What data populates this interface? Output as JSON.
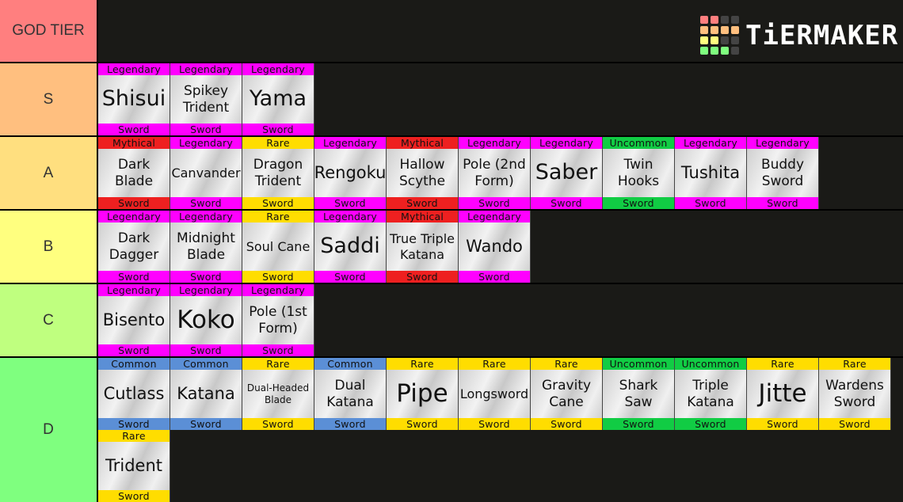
{
  "logo": {
    "text": "TiERMAKER",
    "grid_colors": [
      "#ff7f7f",
      "#ff7f7f",
      "#444444",
      "#444444",
      "#ffbf7f",
      "#ffbf7f",
      "#ffbf7f",
      "#ffbf7f",
      "#ffff7f",
      "#ffff7f",
      "#444444",
      "#444444",
      "#7fff7f",
      "#7fff7f",
      "#7fff7f",
      "#444444"
    ]
  },
  "rarity_colors": {
    "Legendary": "#ff00ff",
    "Mythical": "#ee2020",
    "Rare": "#ffdd00",
    "Uncommon": "#11cc44",
    "Common": "#5b8fd6"
  },
  "tiers": [
    {
      "label": "GOD TIER",
      "color": "#ff7f7f",
      "items": []
    },
    {
      "label": "S",
      "color": "#ffbf7f",
      "items": [
        {
          "name": "Shisui",
          "rarity": "Legendary",
          "type": "Sword",
          "size": "l"
        },
        {
          "name": "Spikey Trident",
          "rarity": "Legendary",
          "type": "Sword",
          "size": "s"
        },
        {
          "name": "Yama",
          "rarity": "Legendary",
          "type": "Sword",
          "size": "l"
        }
      ]
    },
    {
      "label": "A",
      "color": "#ffdf7f",
      "items": [
        {
          "name": "Dark Blade",
          "rarity": "Mythical",
          "type": "Sword",
          "size": "s"
        },
        {
          "name": "Canvander",
          "rarity": "Legendary",
          "type": "Sword",
          "size": "xs"
        },
        {
          "name": "Dragon Trident",
          "rarity": "Rare",
          "type": "Sword",
          "size": "s"
        },
        {
          "name": "Rengoku",
          "rarity": "Legendary",
          "type": "Sword",
          "size": "m"
        },
        {
          "name": "Hallow Scythe",
          "rarity": "Mythical",
          "type": "Sword",
          "size": "s"
        },
        {
          "name": "Pole (2nd Form)",
          "rarity": "Legendary",
          "type": "Sword",
          "size": "s"
        },
        {
          "name": "Saber",
          "rarity": "Legendary",
          "type": "Sword",
          "size": "l"
        },
        {
          "name": "Twin Hooks",
          "rarity": "Uncommon",
          "type": "Sword",
          "size": "s"
        },
        {
          "name": "Tushita",
          "rarity": "Legendary",
          "type": "Sword",
          "size": "m"
        },
        {
          "name": "Buddy Sword",
          "rarity": "Legendary",
          "type": "Sword",
          "size": "s"
        }
      ]
    },
    {
      "label": "B",
      "color": "#ffff7f",
      "items": [
        {
          "name": "Dark Dagger",
          "rarity": "Legendary",
          "type": "Sword",
          "size": "s"
        },
        {
          "name": "Midnight Blade",
          "rarity": "Legendary",
          "type": "Sword",
          "size": "s"
        },
        {
          "name": "Soul Cane",
          "rarity": "Rare",
          "type": "Sword",
          "size": "xs"
        },
        {
          "name": "Saddi",
          "rarity": "Legendary",
          "type": "Sword",
          "size": "l"
        },
        {
          "name": "True Triple Katana",
          "rarity": "Mythical",
          "type": "Sword",
          "size": "xs"
        },
        {
          "name": "Wando",
          "rarity": "Legendary",
          "type": "Sword",
          "size": "m"
        }
      ]
    },
    {
      "label": "C",
      "color": "#bfff7f",
      "items": [
        {
          "name": "Bisento",
          "rarity": "Legendary",
          "type": "Sword",
          "size": "m"
        },
        {
          "name": "Koko",
          "rarity": "Legendary",
          "type": "Sword",
          "size": "xl"
        },
        {
          "name": "Pole (1st Form)",
          "rarity": "Legendary",
          "type": "Sword",
          "size": "s"
        }
      ]
    },
    {
      "label": "D",
      "color": "#7fff7f",
      "items": [
        {
          "name": "Cutlass",
          "rarity": "Common",
          "type": "Sword",
          "size": "m"
        },
        {
          "name": "Katana",
          "rarity": "Common",
          "type": "Sword",
          "size": "m"
        },
        {
          "name": "Dual-Headed Blade",
          "rarity": "Rare",
          "type": "Sword",
          "size": "xxs"
        },
        {
          "name": "Dual Katana",
          "rarity": "Common",
          "type": "Sword",
          "size": "s"
        },
        {
          "name": "Pipe",
          "rarity": "Rare",
          "type": "Sword",
          "size": "xl"
        },
        {
          "name": "Longsword",
          "rarity": "Rare",
          "type": "Sword",
          "size": "xs"
        },
        {
          "name": "Gravity Cane",
          "rarity": "Rare",
          "type": "Sword",
          "size": "s"
        },
        {
          "name": "Shark Saw",
          "rarity": "Uncommon",
          "type": "Sword",
          "size": "s"
        },
        {
          "name": "Triple Katana",
          "rarity": "Uncommon",
          "type": "Sword",
          "size": "s"
        },
        {
          "name": "Jitte",
          "rarity": "Rare",
          "type": "Sword",
          "size": "xl"
        },
        {
          "name": "Wardens Sword",
          "rarity": "Rare",
          "type": "Sword",
          "size": "s"
        },
        {
          "name": "Trident",
          "rarity": "Rare",
          "type": "Sword",
          "size": "m"
        }
      ]
    }
  ]
}
